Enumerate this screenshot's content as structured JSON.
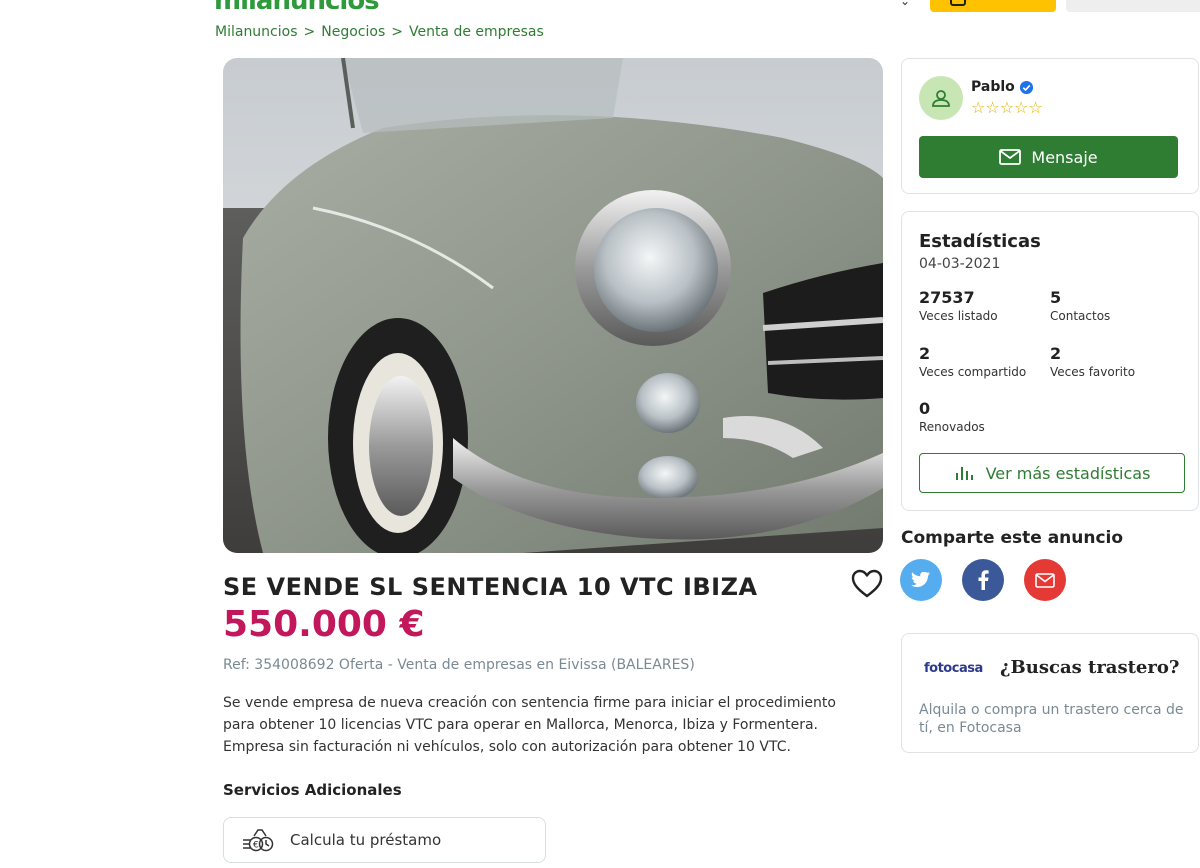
{
  "header": {
    "logo_text": "milanuncios"
  },
  "breadcrumb": [
    "Milanuncios",
    "Negocios",
    "Venta de empresas"
  ],
  "breadcrumb_separator": ">",
  "listing": {
    "title": "SE VENDE SL SENTENCIA 10 VTC IBIZA",
    "price": "550.000 €",
    "ref": "Ref: 354008692 Oferta - Venta de empresas en Eivissa (BALEARES)",
    "description": "Se vende empresa de nueva creación con sentencia firme para iniciar el procedimiento para obtener 10 licencias VTC para operar en Mallorca, Menorca, Ibiza y Formentera. Empresa sin facturación ni vehículos, solo con autorización para obtener 10 VTC.",
    "services_heading": "Servicios Adicionales",
    "loan_button": "Calcula tu préstamo"
  },
  "seller": {
    "name": "Pablo",
    "rating_stars": 0,
    "rating_max": 5,
    "message_button": "Mensaje"
  },
  "stats": {
    "heading": "Estadísticas",
    "date": "04-03-2021",
    "items": [
      {
        "value": "27537",
        "label": "Veces listado"
      },
      {
        "value": "5",
        "label": "Contactos"
      },
      {
        "value": "2",
        "label": "Veces compartido"
      },
      {
        "value": "2",
        "label": "Veces favorito"
      },
      {
        "value": "0",
        "label": "Renovados"
      }
    ],
    "more_button": "Ver más estadísticas"
  },
  "share": {
    "heading": "Comparte este anuncio"
  },
  "ad": {
    "brand": "fotocasa",
    "title": "¿Buscas trastero?",
    "text": "Alquila o compra un trastero cerca de tí, en Fotocasa"
  },
  "colors": {
    "accent_green": "#2e7d32",
    "price": "#c2185b",
    "brand_yellow": "#ffc200"
  }
}
